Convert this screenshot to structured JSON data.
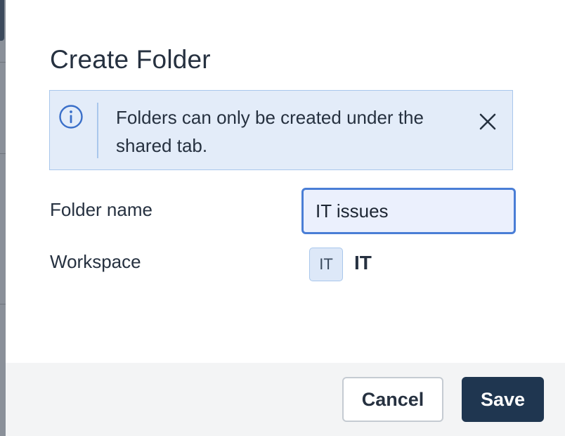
{
  "dialog": {
    "title": "Create Folder",
    "info_message": "Folders can only be created under the shared tab.",
    "info_icon": "info-icon",
    "close_icon": "close-icon"
  },
  "form": {
    "folder_name_label": "Folder name",
    "folder_name_value": "IT issues",
    "workspace_label": "Workspace",
    "workspace_badge": "IT",
    "workspace_name": "IT"
  },
  "footer": {
    "cancel_label": "Cancel",
    "save_label": "Save"
  },
  "colors": {
    "primary_button": "#1f3650",
    "info_background": "#e3ecf9",
    "info_border": "#a9c7ec",
    "input_focus_border": "#4a7ed6"
  }
}
